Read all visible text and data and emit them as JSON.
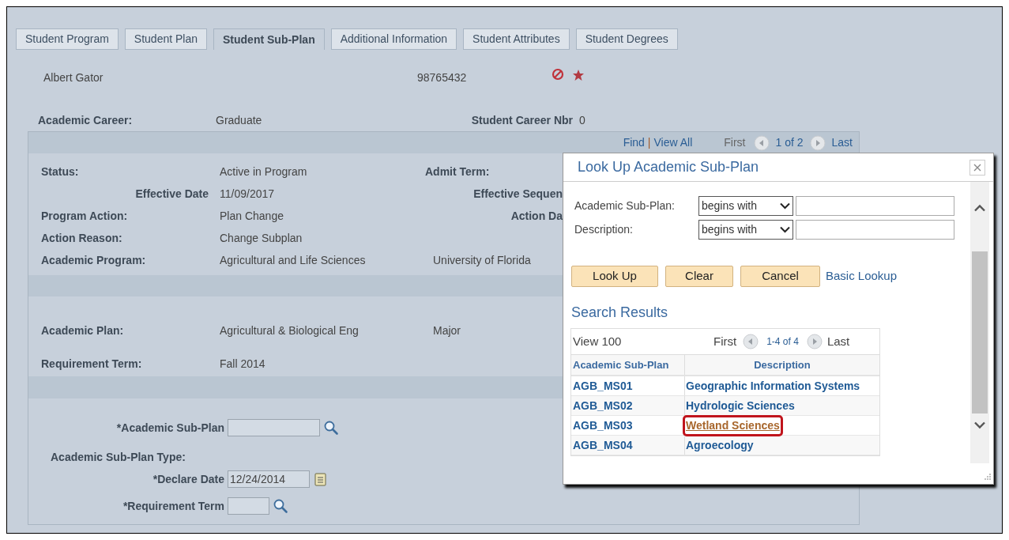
{
  "tabs": [
    {
      "label": "Student Program",
      "selected": false
    },
    {
      "label": "Student Plan",
      "selected": false
    },
    {
      "label": "Student Sub-Plan",
      "selected": true
    },
    {
      "label": "Additional Information",
      "selected": false
    },
    {
      "label": "Student Attributes",
      "selected": false
    },
    {
      "label": "Student Degrees",
      "selected": false
    }
  ],
  "student": {
    "name": "Albert Gator",
    "id": "98765432"
  },
  "career": {
    "label": "Academic Career:",
    "value": "Graduate",
    "nbr_label": "Student Career Nbr",
    "nbr_value": "0"
  },
  "navigation": {
    "find": "Find",
    "separator": "|",
    "view_all": "View All",
    "first": "First",
    "page": "1 of 2",
    "last": "Last"
  },
  "program_rows": [
    {
      "kind": "primary",
      "label": "Status:",
      "value": "Active in Program",
      "extra": {
        "kind": "label",
        "text": "Admit Term:"
      }
    },
    {
      "kind": "secondary",
      "label": "Effective Date",
      "value": "11/09/2017",
      "extra": {
        "kind": "cut_label",
        "text": "Effective Sequen"
      }
    },
    {
      "kind": "primary",
      "label": "Program Action:",
      "value": "Plan Change",
      "extra": {
        "kind": "cut_label",
        "text": "Action Da"
      }
    },
    {
      "kind": "primary",
      "label": "Action Reason:",
      "value": "Change Subplan"
    },
    {
      "kind": "primary",
      "label": "Academic Program:",
      "value": "Agricultural and Life Sciences",
      "extra": {
        "kind": "value",
        "text": "University of Florida"
      }
    }
  ],
  "plan_rows": [
    {
      "kind": "primary",
      "label": "Academic Plan:",
      "value": "Agricultural & Biological Eng",
      "extra": {
        "kind": "value",
        "text": "Major"
      }
    },
    {
      "kind": "primary",
      "label": "Requirement Term:",
      "value": "Fall 2014"
    }
  ],
  "sub_plan_form": [
    {
      "kind": "lookup",
      "label": "*Academic Sub-Plan"
    },
    {
      "kind": "heading",
      "label": "Academic Sub-Plan Type:"
    },
    {
      "kind": "date",
      "label": "*Declare Date",
      "value": "12/24/2014"
    },
    {
      "kind": "lookup_short",
      "label": "*Requirement Term"
    }
  ],
  "modal": {
    "title": "Look Up Academic Sub-Plan",
    "criteria": [
      {
        "label": "Academic Sub-Plan:",
        "operator": "begins with"
      },
      {
        "label": "Description:",
        "operator": "begins with"
      }
    ],
    "buttons": [
      "Look Up",
      "Clear",
      "Cancel"
    ],
    "basic_lookup": "Basic Lookup",
    "results_title": "Search Results",
    "results": {
      "view": "View 100",
      "first": "First",
      "range": "1-4 of 4",
      "last": "Last",
      "columns": [
        "Academic Sub-Plan",
        "Description"
      ],
      "rows": [
        {
          "code": "AGB_MS01",
          "description": "Geographic Information Systems",
          "selected": false
        },
        {
          "code": "AGB_MS02",
          "description": "Hydrologic Sciences",
          "selected": false
        },
        {
          "code": "AGB_MS03",
          "description": "Wetland Sciences",
          "selected": true
        },
        {
          "code": "AGB_MS04",
          "description": "Agroecology",
          "selected": false
        }
      ]
    }
  }
}
